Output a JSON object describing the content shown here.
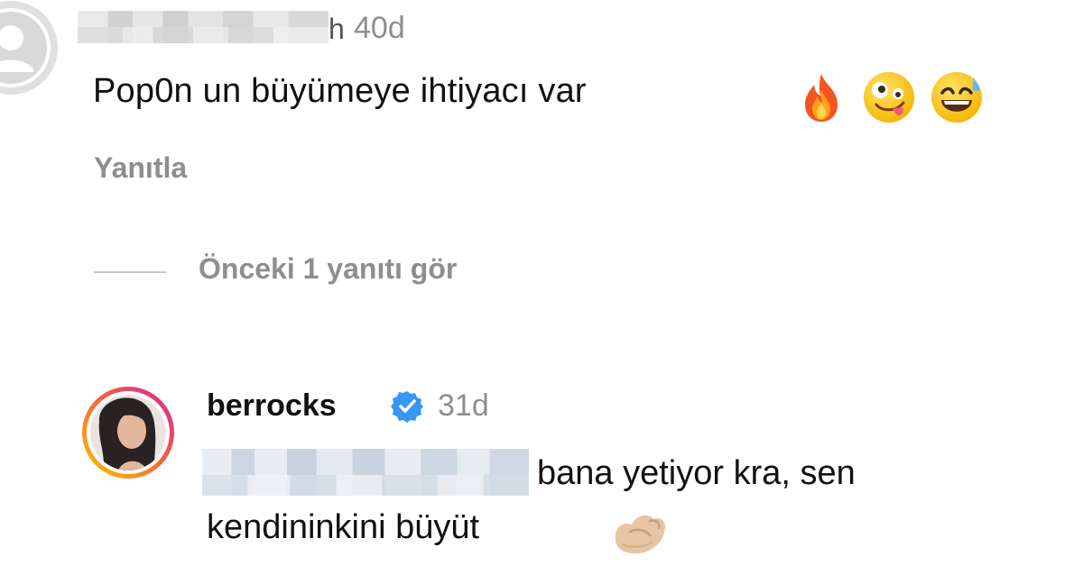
{
  "top_comment": {
    "username_tail": "h",
    "timestamp": "40d",
    "text": "Pop0n un büyümeye ihtiyacı var",
    "emojis": [
      "fire-emoji",
      "zany-face-emoji",
      "sweat-smile-emoji"
    ],
    "reply_label": "Yanıtla",
    "view_previous_label": "Önceki 1 yanıtı gör"
  },
  "reply": {
    "username": "berrocks",
    "verified": true,
    "timestamp": "31d",
    "text_line1": "bana yetiyor kra, sen",
    "text_line2": "kendininkini büyüt",
    "emoji": "pinching-hand-emoji"
  },
  "colors": {
    "primary_text": "#111111",
    "secondary_text": "#8e8e8e",
    "verified_blue": "#3897f0",
    "story_ring_start": "#f9c700",
    "story_ring_end": "#d6249f"
  }
}
